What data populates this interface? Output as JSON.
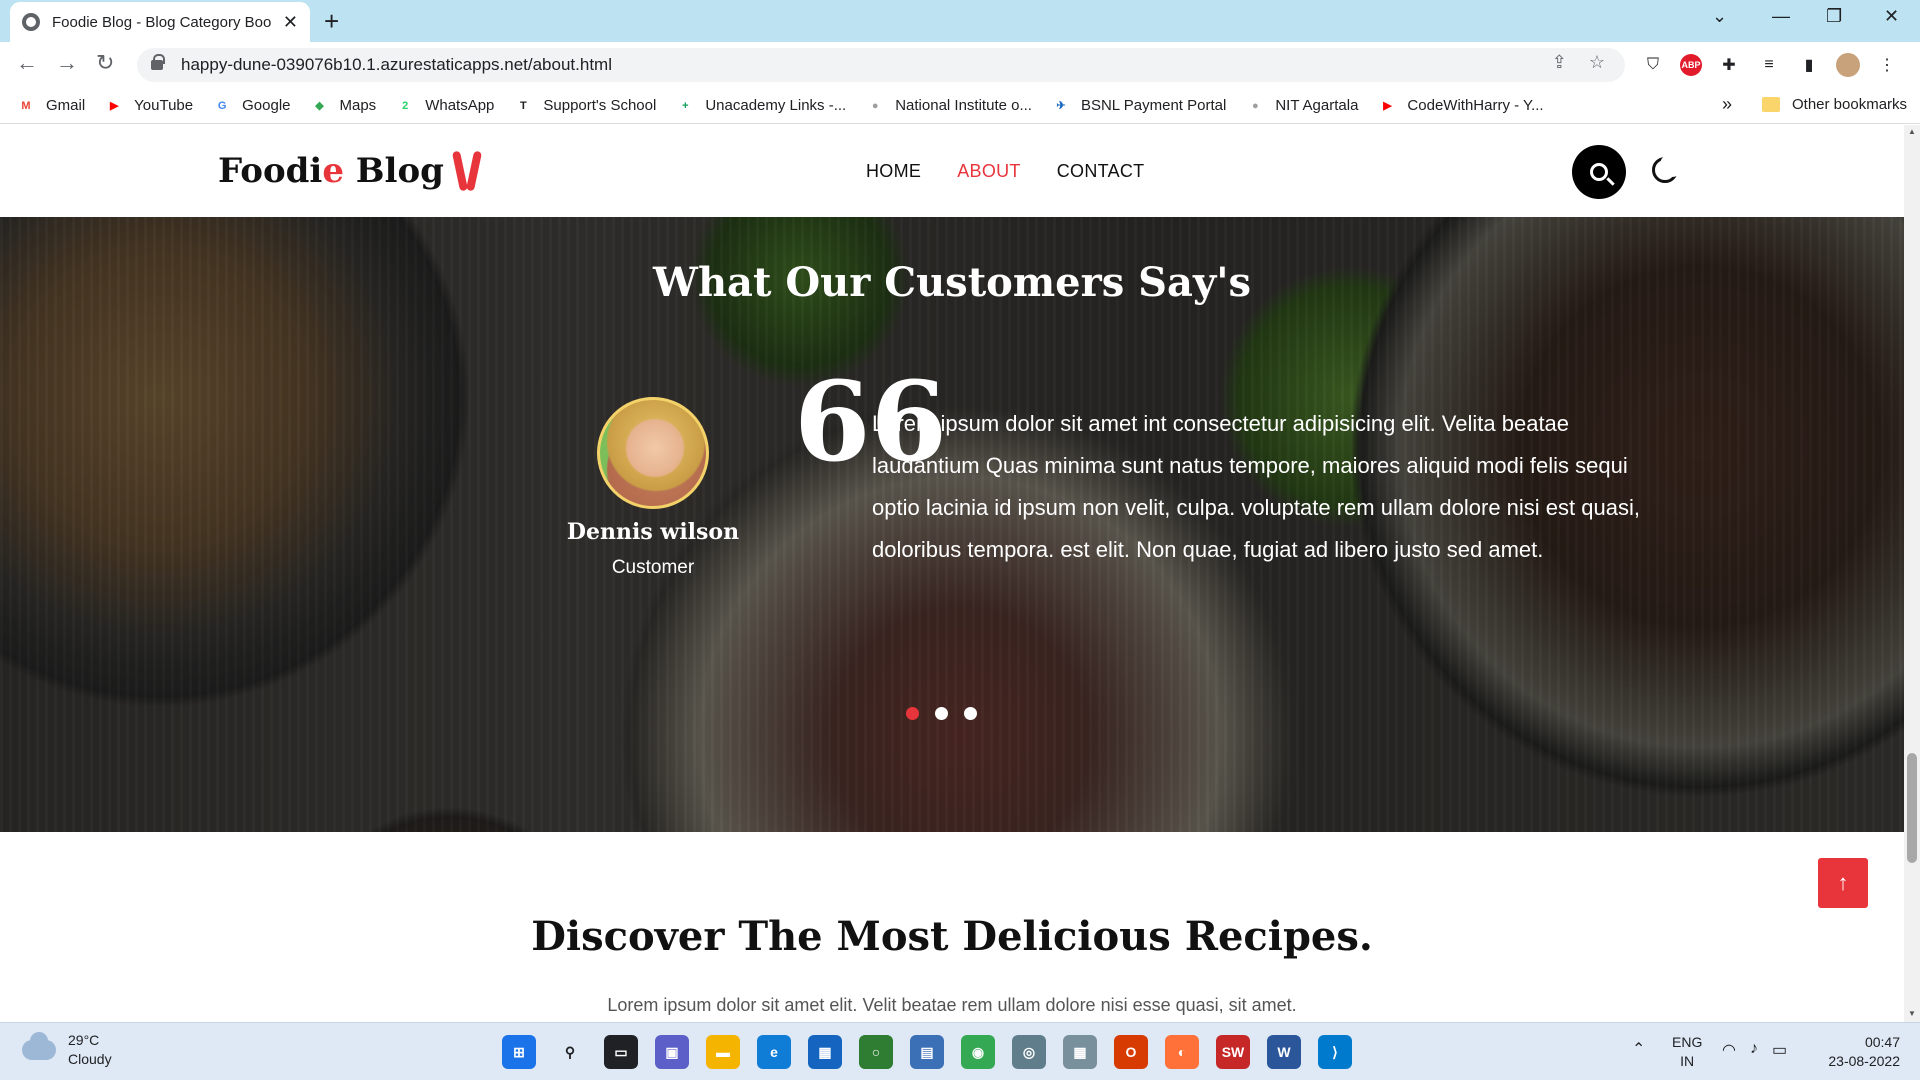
{
  "browser": {
    "tab_title": "Foodie Blog - Blog Category Boo",
    "url": "happy-dune-039076b10.1.azurestaticapps.net/about.html",
    "bookmarks": [
      {
        "label": "Gmail",
        "color": "#ea4335",
        "glyph": "M"
      },
      {
        "label": "YouTube",
        "color": "#ff0000",
        "glyph": "▶"
      },
      {
        "label": "Google",
        "color": "#4285f4",
        "glyph": "G"
      },
      {
        "label": "Maps",
        "color": "#34a853",
        "glyph": "◆"
      },
      {
        "label": "WhatsApp",
        "color": "#25d366",
        "glyph": "2"
      },
      {
        "label": "Support's School",
        "color": "#202124",
        "glyph": "T"
      },
      {
        "label": "Unacademy Links -...",
        "color": "#0f9d58",
        "glyph": "+"
      },
      {
        "label": "National Institute o...",
        "color": "#9e9e9e",
        "glyph": "●"
      },
      {
        "label": "BSNL Payment Portal",
        "color": "#1565c0",
        "glyph": "✈"
      },
      {
        "label": "NIT Agartala",
        "color": "#9e9e9e",
        "glyph": "●"
      },
      {
        "label": "CodeWithHarry - Y...",
        "color": "#ff0000",
        "glyph": "▶"
      }
    ],
    "bookmarks_more": "»",
    "other_bookmarks": "Other bookmarks"
  },
  "site": {
    "logo_main": "Foodi",
    "logo_accent": "e",
    "logo_rest": " Blog",
    "nav": [
      {
        "label": "HOME",
        "active": false
      },
      {
        "label": "ABOUT",
        "active": true
      },
      {
        "label": "CONTACT",
        "active": false
      }
    ],
    "accent_color": "#e8353c"
  },
  "testimonial": {
    "section_title": "What Our Customers Say's",
    "name": "Dennis wilson",
    "role": "Customer",
    "quote": "Lorem ipsum dolor sit amet int consectetur adipisicing elit. Velita beatae laudantium Quas minima sunt natus tempore, maiores aliquid modi felis sequi optio lacinia id ipsum non velit, culpa. voluptate rem ullam dolore nisi est quasi, doloribus tempora. est elit. Non quae, fugiat ad libero justo sed amet.",
    "quote_mark": "66",
    "slides": 3,
    "active_slide": 0
  },
  "recipes": {
    "title": "Discover The Most Delicious Recipes.",
    "subtitle": "Lorem ipsum dolor sit amet elit. Velit beatae rem ullam dolore nisi esse quasi, sit amet."
  },
  "taskbar": {
    "temperature": "29°C",
    "condition": "Cloudy",
    "lang_primary": "ENG",
    "lang_secondary": "IN",
    "time": "00:47",
    "date": "23-08-2022"
  }
}
